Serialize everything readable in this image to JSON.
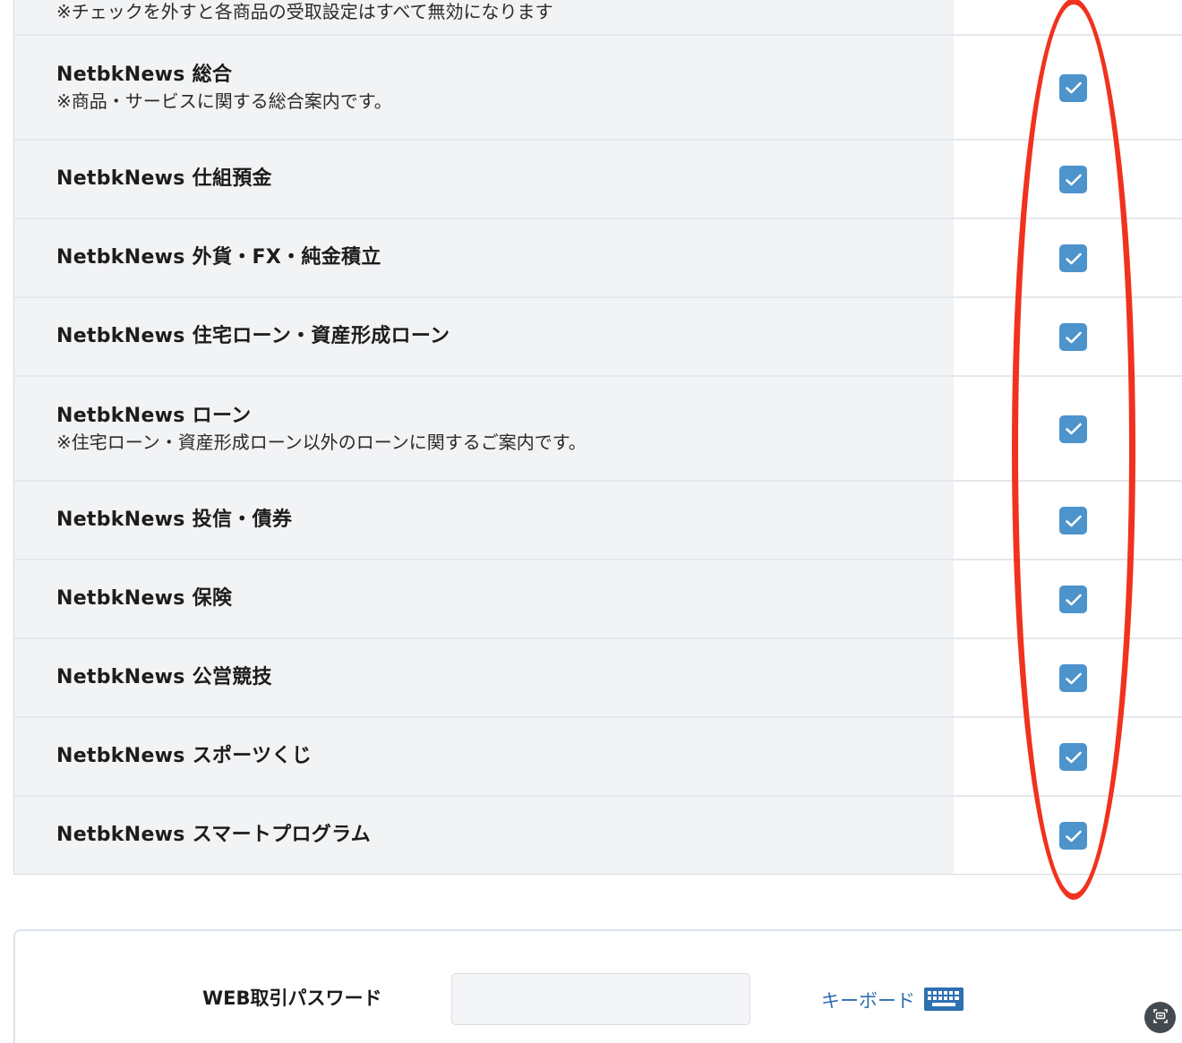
{
  "notice_text": "※チェックを外すと各商品の受取設定はすべて無効になります",
  "rows": [
    {
      "title": "NetbkNews 総合",
      "note": "※商品・サービスに関する総合案内です。",
      "checked": true
    },
    {
      "title": "NetbkNews 仕組預金",
      "checked": true
    },
    {
      "title": "NetbkNews 外貨・FX・純金積立",
      "checked": true
    },
    {
      "title": "NetbkNews 住宅ローン・資産形成ローン",
      "checked": true
    },
    {
      "title": "NetbkNews ローン",
      "note": "※住宅ローン・資産形成ローン以外のローンに関するご案内です。",
      "checked": true
    },
    {
      "title": "NetbkNews 投信・債券",
      "checked": true
    },
    {
      "title": "NetbkNews 保険",
      "checked": true
    },
    {
      "title": "NetbkNews 公営競技",
      "checked": true
    },
    {
      "title": "NetbkNews スポーツくじ",
      "checked": true
    },
    {
      "title": "NetbkNews スマートプログラム",
      "checked": true
    }
  ],
  "password_section": {
    "label": "WEB取引パスワード",
    "value": "",
    "keyboard_label": "キーボード"
  },
  "colors": {
    "checkbox": "#4d93cc",
    "highlight": "#f0321e",
    "link": "#2e6fb0",
    "row_background": "#f2f3f5"
  }
}
